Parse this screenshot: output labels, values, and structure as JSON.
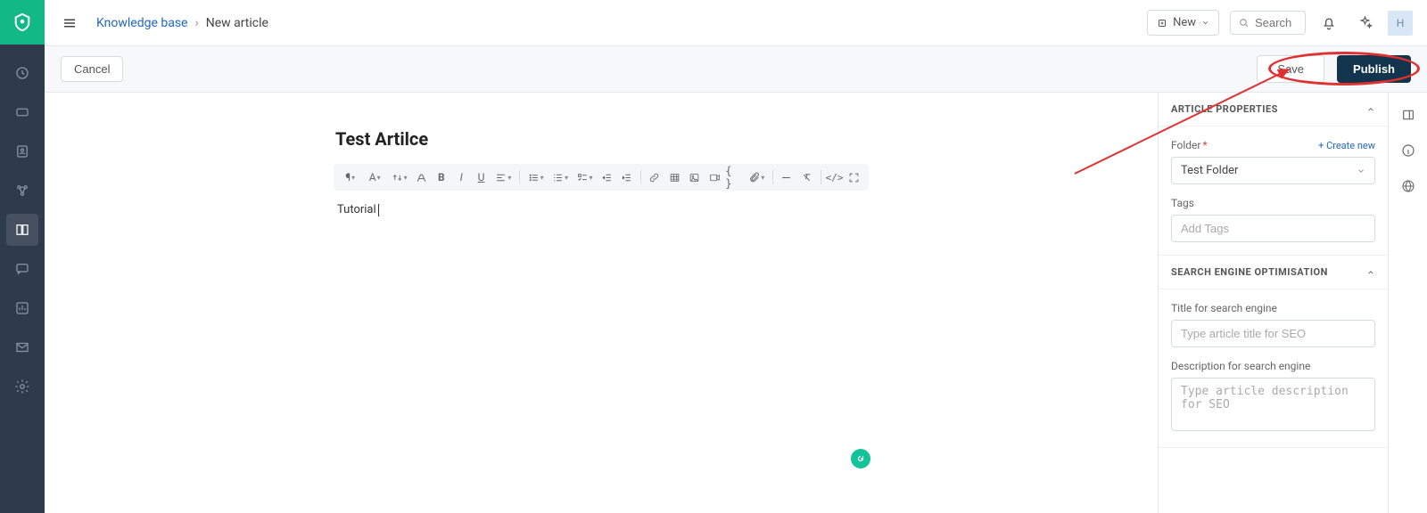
{
  "header": {
    "breadcrumb_root": "Knowledge base",
    "breadcrumb_current": "New article",
    "new_button": "New",
    "search_placeholder": "Search",
    "avatar_letter": "H"
  },
  "actions": {
    "cancel": "Cancel",
    "save": "Save",
    "publish": "Publish"
  },
  "editor": {
    "title": "Test Artilce",
    "body": "Tutorial"
  },
  "props": {
    "article_heading": "ARTICLE PROPERTIES",
    "folder_label": "Folder",
    "create_new": "+ Create new",
    "folder_value": "Test Folder",
    "tags_label": "Tags",
    "tags_placeholder": "Add Tags",
    "seo_heading": "SEARCH ENGINE OPTIMISATION",
    "seo_title_label": "Title for search engine",
    "seo_title_placeholder": "Type article title for SEO",
    "seo_desc_label": "Description for search engine",
    "seo_desc_placeholder": "Type article description for SEO"
  },
  "annotation": {
    "color": "#e03131"
  }
}
